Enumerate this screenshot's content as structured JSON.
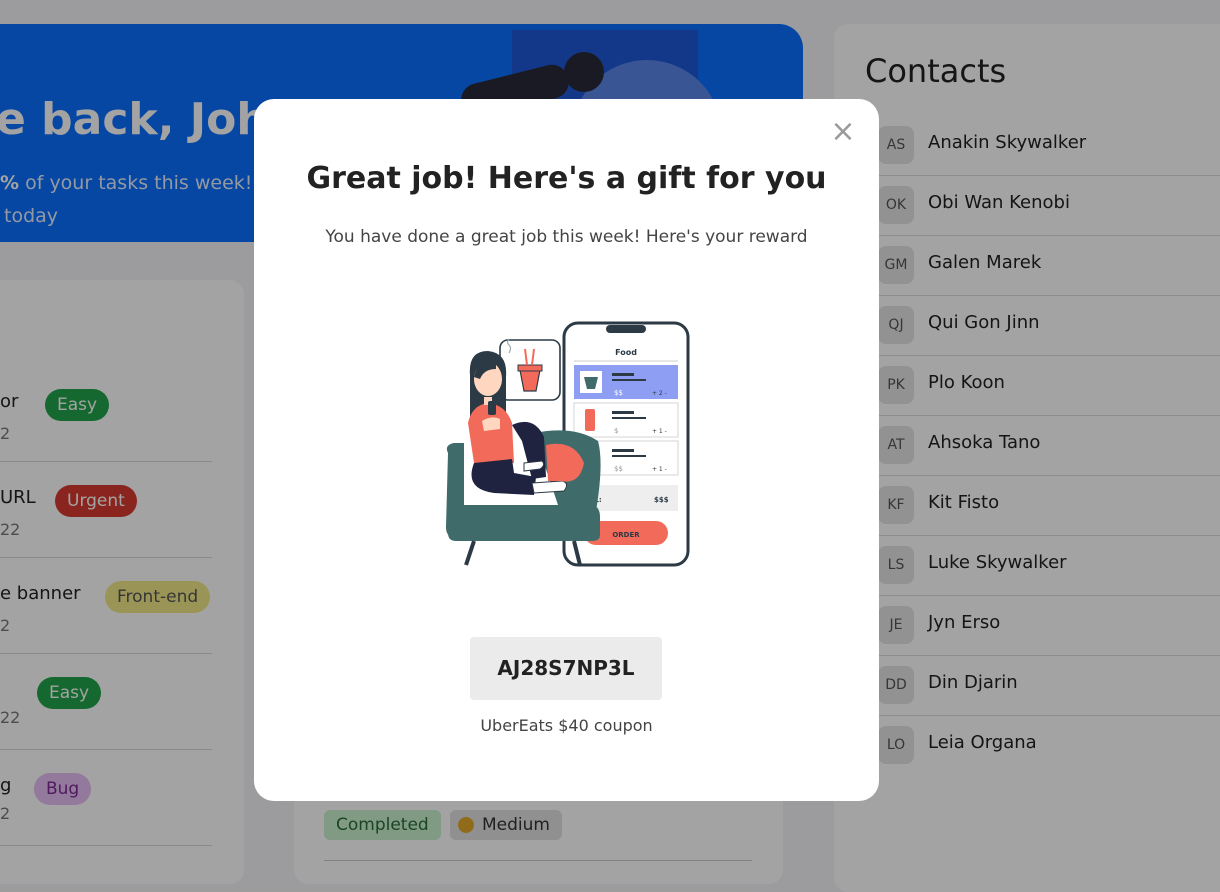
{
  "banner": {
    "title": "e back, John",
    "wave_icon": "waving-hand-icon",
    "line1_pct": "%",
    "line1_rest": " of your tasks this week!",
    "line2": " today"
  },
  "tasks": [
    {
      "title": "or",
      "date": "2",
      "tag": "Easy",
      "tag_type": "easy"
    },
    {
      "title": "URL",
      "date": "22",
      "tag": "Urgent",
      "tag_type": "urgent"
    },
    {
      "title": "e banner",
      "date": "2",
      "tag": "Front-end",
      "tag_type": "frontend"
    },
    {
      "title": "",
      "date": "22",
      "tag": "Easy",
      "tag_type": "easy"
    },
    {
      "title": "g",
      "date": "2",
      "tag": "Bug",
      "tag_type": "bug"
    }
  ],
  "task_card": {
    "status": "Completed",
    "priority": "Medium"
  },
  "contacts": {
    "title": "Contacts",
    "items": [
      {
        "initials": "AS",
        "name": "Anakin Skywalker"
      },
      {
        "initials": "OK",
        "name": "Obi Wan Kenobi"
      },
      {
        "initials": "GM",
        "name": "Galen Marek"
      },
      {
        "initials": "QJ",
        "name": "Qui Gon Jinn"
      },
      {
        "initials": "PK",
        "name": "Plo Koon"
      },
      {
        "initials": "AT",
        "name": "Ahsoka Tano"
      },
      {
        "initials": "KF",
        "name": "Kit Fisto"
      },
      {
        "initials": "LS",
        "name": "Luke Skywalker"
      },
      {
        "initials": "JE",
        "name": "Jyn Erso"
      },
      {
        "initials": "DD",
        "name": "Din Djarin"
      },
      {
        "initials": "LO",
        "name": "Leia Organa"
      }
    ]
  },
  "modal": {
    "close_symbol": "×",
    "title": "Great job! Here's a gift for you",
    "subtitle": "You have done a great job this week! Here's your reward",
    "illustration": {
      "phone_header": "Food",
      "price1": "$$",
      "qty1": "+ 2 -",
      "price2": "$",
      "qty2": "+ 1 -",
      "price3": "$$",
      "qty3": "+ 1 -",
      "total_label": "AL:",
      "total_value": "$$$",
      "order_button": "ORDER"
    },
    "coupon_code": "AJ28S7NP3L",
    "coupon_label": "UberEats $40 coupon"
  },
  "colors": {
    "banner_blue": "#0a6fff",
    "overlay": "rgba(0,0,0,0.36)",
    "accent_orange": "#f26b5a",
    "chair_teal": "#3f6b6b",
    "phone_highlight": "#8e9ff3"
  }
}
